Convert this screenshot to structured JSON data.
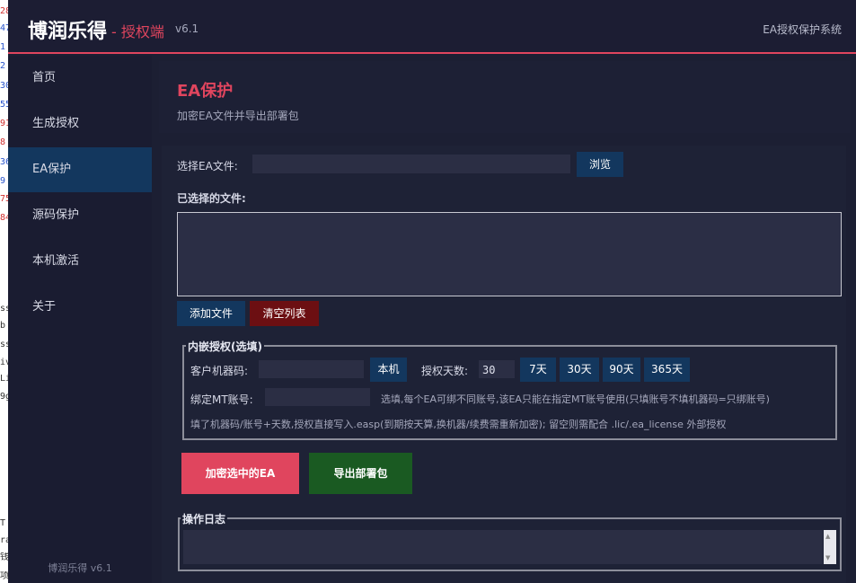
{
  "background_strip": {
    "glyphs": [
      {
        "text": "28",
        "color": "#d03030"
      },
      {
        "text": "47",
        "color": "#2a55cc"
      },
      {
        "text": "1",
        "color": "#2a55cc"
      },
      {
        "text": "2",
        "color": "#2a55cc"
      },
      {
        "text": "30",
        "color": "#2a55cc"
      },
      {
        "text": "55",
        "color": "#2a55cc"
      },
      {
        "text": "91",
        "color": "#d03030"
      },
      {
        "text": "8",
        "color": "#d03030"
      },
      {
        "text": "36",
        "color": "#2a55cc"
      },
      {
        "text": "9",
        "color": "#2a55cc"
      },
      {
        "text": "75",
        "color": "#d03030"
      },
      {
        "text": "84",
        "color": "#d03030"
      },
      {
        "text": "ss",
        "color": "#333333"
      },
      {
        "text": "b",
        "color": "#333333"
      },
      {
        "text": "ss",
        "color": "#333333"
      },
      {
        "text": "iv",
        "color": "#333333"
      },
      {
        "text": "Li",
        "color": "#333333"
      },
      {
        "text": "9g",
        "color": "#333333"
      },
      {
        "text": "T",
        "color": "#333333"
      },
      {
        "text": "ra",
        "color": "#333333"
      },
      {
        "text": "钱",
        "color": "#333333"
      },
      {
        "text": "项",
        "color": "#333333"
      }
    ]
  },
  "header": {
    "brand": "博润乐得",
    "brand_sub": "- 授权端",
    "version": "v6.1",
    "system_title": "EA授权保护系统"
  },
  "sidebar": {
    "items": [
      {
        "label": "首页",
        "active": false
      },
      {
        "label": "生成授权",
        "active": false
      },
      {
        "label": "EA保护",
        "active": true
      },
      {
        "label": "源码保护",
        "active": false
      },
      {
        "label": "本机激活",
        "active": false
      },
      {
        "label": "关于",
        "active": false
      }
    ],
    "footer": "博润乐得 v6.1"
  },
  "page": {
    "title": "EA保护",
    "description": "加密EA文件并导出部署包"
  },
  "file_select": {
    "label": "选择EA文件:",
    "value": "",
    "browse_label": "浏览"
  },
  "selected_files": {
    "label": "已选择的文件:",
    "items": [],
    "add_label": "添加文件",
    "clear_label": "清空列表"
  },
  "embed_auth": {
    "legend": "内嵌授权(选填)",
    "machine_label": "客户机器码:",
    "machine_value": "",
    "local_label": "本机",
    "days_label": "授权天数:",
    "days_value": "30",
    "day_presets": [
      "7天",
      "30天",
      "90天",
      "365天"
    ],
    "mt_label": "绑定MT账号:",
    "mt_value": "",
    "mt_hint": "选填,每个EA可绑不同账号,该EA只能在指定MT账号使用(只填账号不填机器码=只绑账号)",
    "footer_hint": "填了机器码/账号+天数,授权直接写入.easp(到期按天算,换机器/续费需重新加密); 留空则需配合 .lic/.ea_license 外部授权"
  },
  "actions": {
    "encrypt_label": "加密选中的EA",
    "export_label": "导出部署包"
  },
  "log": {
    "legend": "操作日志",
    "content": ""
  },
  "colors": {
    "accent": "#e0455e",
    "nav_active": "#13375e",
    "button_blue": "#13375e",
    "button_clear": "#6c0f12",
    "button_export": "#1a5a22"
  }
}
